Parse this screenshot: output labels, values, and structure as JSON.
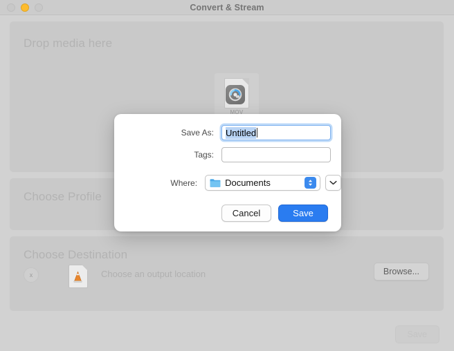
{
  "window": {
    "title": "Convert & Stream",
    "traffic_lights": [
      {
        "name": "close",
        "color": "#c8c8c8"
      },
      {
        "name": "minimize",
        "color": "#febc2e"
      },
      {
        "name": "maximize",
        "color": "#c8c8c8"
      }
    ]
  },
  "panels": {
    "drop": {
      "label": "Drop media here",
      "file_icon": {
        "type": "mov-file-icon",
        "caption": "MOV"
      }
    },
    "profile": {
      "label": "Choose Profile"
    },
    "destination": {
      "label": "Choose Destination",
      "remove_button": "x",
      "output_placeholder": "Choose an output location",
      "browse_label": "Browse..."
    }
  },
  "footer": {
    "save_label": "Save",
    "save_enabled": false
  },
  "save_sheet": {
    "save_as": {
      "label": "Save As:",
      "value": "Untitled",
      "selected": true
    },
    "tags": {
      "label": "Tags:",
      "value": "",
      "placeholder": ""
    },
    "where": {
      "label": "Where:",
      "value": "Documents",
      "folder_icon": "folder-icon",
      "stepper_icon": "up-down-chevron-icon",
      "expand_icon": "chevron-down-icon"
    },
    "buttons": {
      "cancel": "Cancel",
      "save": "Save"
    }
  },
  "colors": {
    "accent_blue": "#2a7cf0",
    "stepper_blue": "#3b8aee",
    "selection_blue": "#b9d4f5",
    "window_bg": "#d2d2d2",
    "panel_bg": "#c9c9c9",
    "minimize_yellow": "#febc2e"
  }
}
